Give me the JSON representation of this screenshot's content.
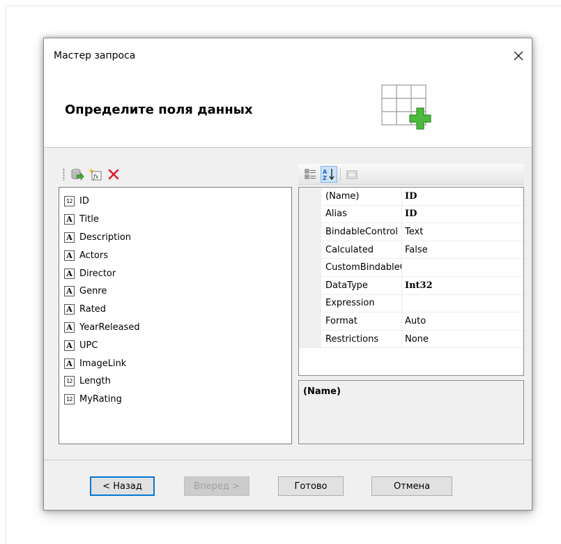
{
  "window": {
    "title": "Мастер запроса",
    "heading": "Определите поля данных"
  },
  "icons": {
    "close": "close-icon",
    "header": "table-add-icon",
    "add_field": "add-field-icon",
    "add_calculated_field": "add-calculated-field-icon",
    "delete_field": "delete-icon",
    "categorized": "categorized-view-icon",
    "alphabetical": "alphabetical-sort-icon",
    "property_pages": "property-pages-icon"
  },
  "fields": [
    {
      "name": "ID",
      "type": "number",
      "badge": "12"
    },
    {
      "name": "Title",
      "type": "text",
      "badge": "A"
    },
    {
      "name": "Description",
      "type": "text",
      "badge": "A"
    },
    {
      "name": "Actors",
      "type": "text",
      "badge": "A"
    },
    {
      "name": "Director",
      "type": "text",
      "badge": "A"
    },
    {
      "name": "Genre",
      "type": "text",
      "badge": "A"
    },
    {
      "name": "Rated",
      "type": "text",
      "badge": "A"
    },
    {
      "name": "YearReleased",
      "type": "text",
      "badge": "A"
    },
    {
      "name": "UPC",
      "type": "text",
      "badge": "A"
    },
    {
      "name": "ImageLink",
      "type": "text",
      "badge": "A"
    },
    {
      "name": "Length",
      "type": "number",
      "badge": "12"
    },
    {
      "name": "MyRating",
      "type": "number",
      "badge": "12"
    }
  ],
  "properties": [
    {
      "name": "(Name)",
      "value": "ID",
      "bold": true
    },
    {
      "name": "Alias",
      "value": "ID",
      "bold": true
    },
    {
      "name": "BindableControl",
      "value": "Text",
      "bold": false
    },
    {
      "name": "Calculated",
      "value": "False",
      "bold": false
    },
    {
      "name": "CustomBindableControl",
      "value": "",
      "bold": false
    },
    {
      "name": "DataType",
      "value": "Int32",
      "bold": true
    },
    {
      "name": "Expression",
      "value": "",
      "bold": false
    },
    {
      "name": "Format",
      "value": "Auto",
      "bold": false
    },
    {
      "name": "Restrictions",
      "value": "None",
      "bold": false
    }
  ],
  "description": {
    "title": "(Name)"
  },
  "buttons": {
    "back": "< Назад",
    "next": "Вперед >",
    "finish": "Готово",
    "cancel": "Отмена"
  },
  "colors": {
    "accent": "#0078d7",
    "delete": "#e81123",
    "add_green": "#3dab3d"
  }
}
